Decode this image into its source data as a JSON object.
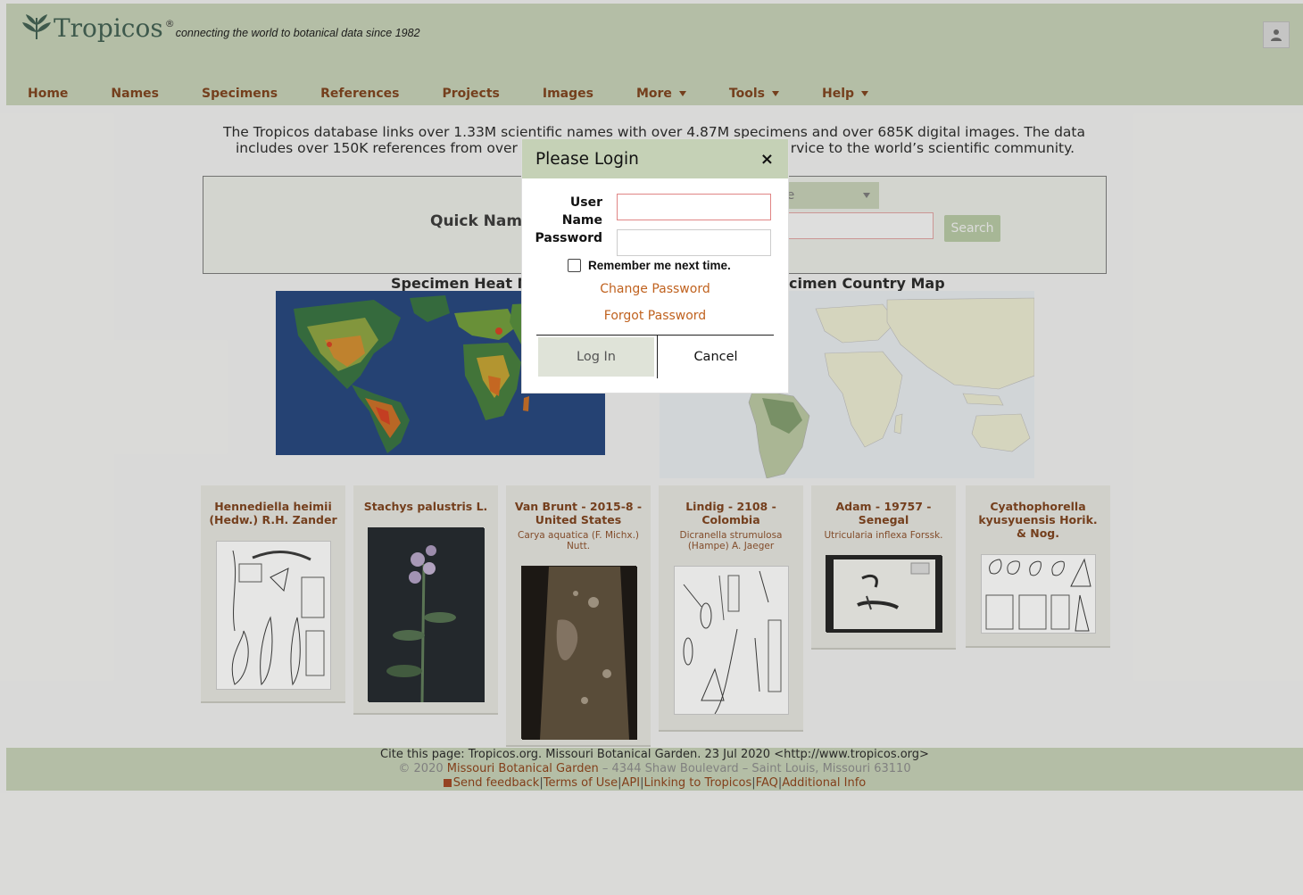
{
  "header": {
    "logo_text": "Tropicos",
    "logo_reg": "®",
    "tagline": "connecting the world to botanical data since 1982"
  },
  "nav": [
    {
      "label": "Home",
      "dropdown": false
    },
    {
      "label": "Names",
      "dropdown": false
    },
    {
      "label": "Specimens",
      "dropdown": false
    },
    {
      "label": "References",
      "dropdown": false
    },
    {
      "label": "Projects",
      "dropdown": false
    },
    {
      "label": "Images",
      "dropdown": false
    },
    {
      "label": "More",
      "dropdown": true
    },
    {
      "label": "Tools",
      "dropdown": true
    },
    {
      "label": "Help",
      "dropdown": true
    }
  ],
  "intro": {
    "line1": "The Tropicos database links over 1.33M scientific names with over 4.87M specimens and over 685K digital images. The data",
    "line2_left": "includes over 150K references from over",
    "line2_right": "rvice to the world’s scientific community."
  },
  "quick_search": {
    "label": "Quick Name",
    "select_value": "me",
    "button_label": "Search"
  },
  "maps": {
    "heat_title": "Specimen Heat Ma",
    "country_title": "cimen Country Map"
  },
  "cards": [
    {
      "title": "Hennediella heimii (Hedw.) R.H. Zander",
      "subtitle": ""
    },
    {
      "title": "Stachys palustris L.",
      "subtitle": ""
    },
    {
      "title": "Van Brunt - 2015-8 -United States",
      "subtitle": "Carya aquatica (F. Michx.) Nutt."
    },
    {
      "title": "Lindig - 2108 - Colombia",
      "subtitle": "Dicranella strumulosa (Hampe) A. Jaeger"
    },
    {
      "title": "Adam - 19757 - Senegal",
      "subtitle": "Utricularia inflexa Forssk."
    },
    {
      "title": "Cyathophorella kyusyuensis Horik. & Nog.",
      "subtitle": ""
    }
  ],
  "footer": {
    "cite": "Cite this page: Tropicos.org. Missouri Botanical Garden. 23 Jul 2020 <http://www.tropicos.org>",
    "copy_prefix": "© 2020 ",
    "copy_link": "Missouri Botanical Garden",
    "copy_suffix": " – 4344 Shaw Boulevard – Saint Louis, Missouri 63110",
    "links": [
      "Send feedback",
      "Terms of Use",
      "API",
      "Linking to Tropicos",
      "FAQ",
      "Additional Info"
    ]
  },
  "modal": {
    "title": "Please Login",
    "close": "×",
    "username_label_1": "User",
    "username_label_2": "Name",
    "password_label": "Password",
    "remember_label": "Remember me next time.",
    "change_password": "Change Password",
    "forgot_password": "Forgot Password",
    "login_button": "Log In",
    "cancel_button": "Cancel"
  },
  "colors": {
    "header_bg": "#c5d1b6",
    "link": "#7a3b14",
    "accent_orange": "#c0621f"
  }
}
